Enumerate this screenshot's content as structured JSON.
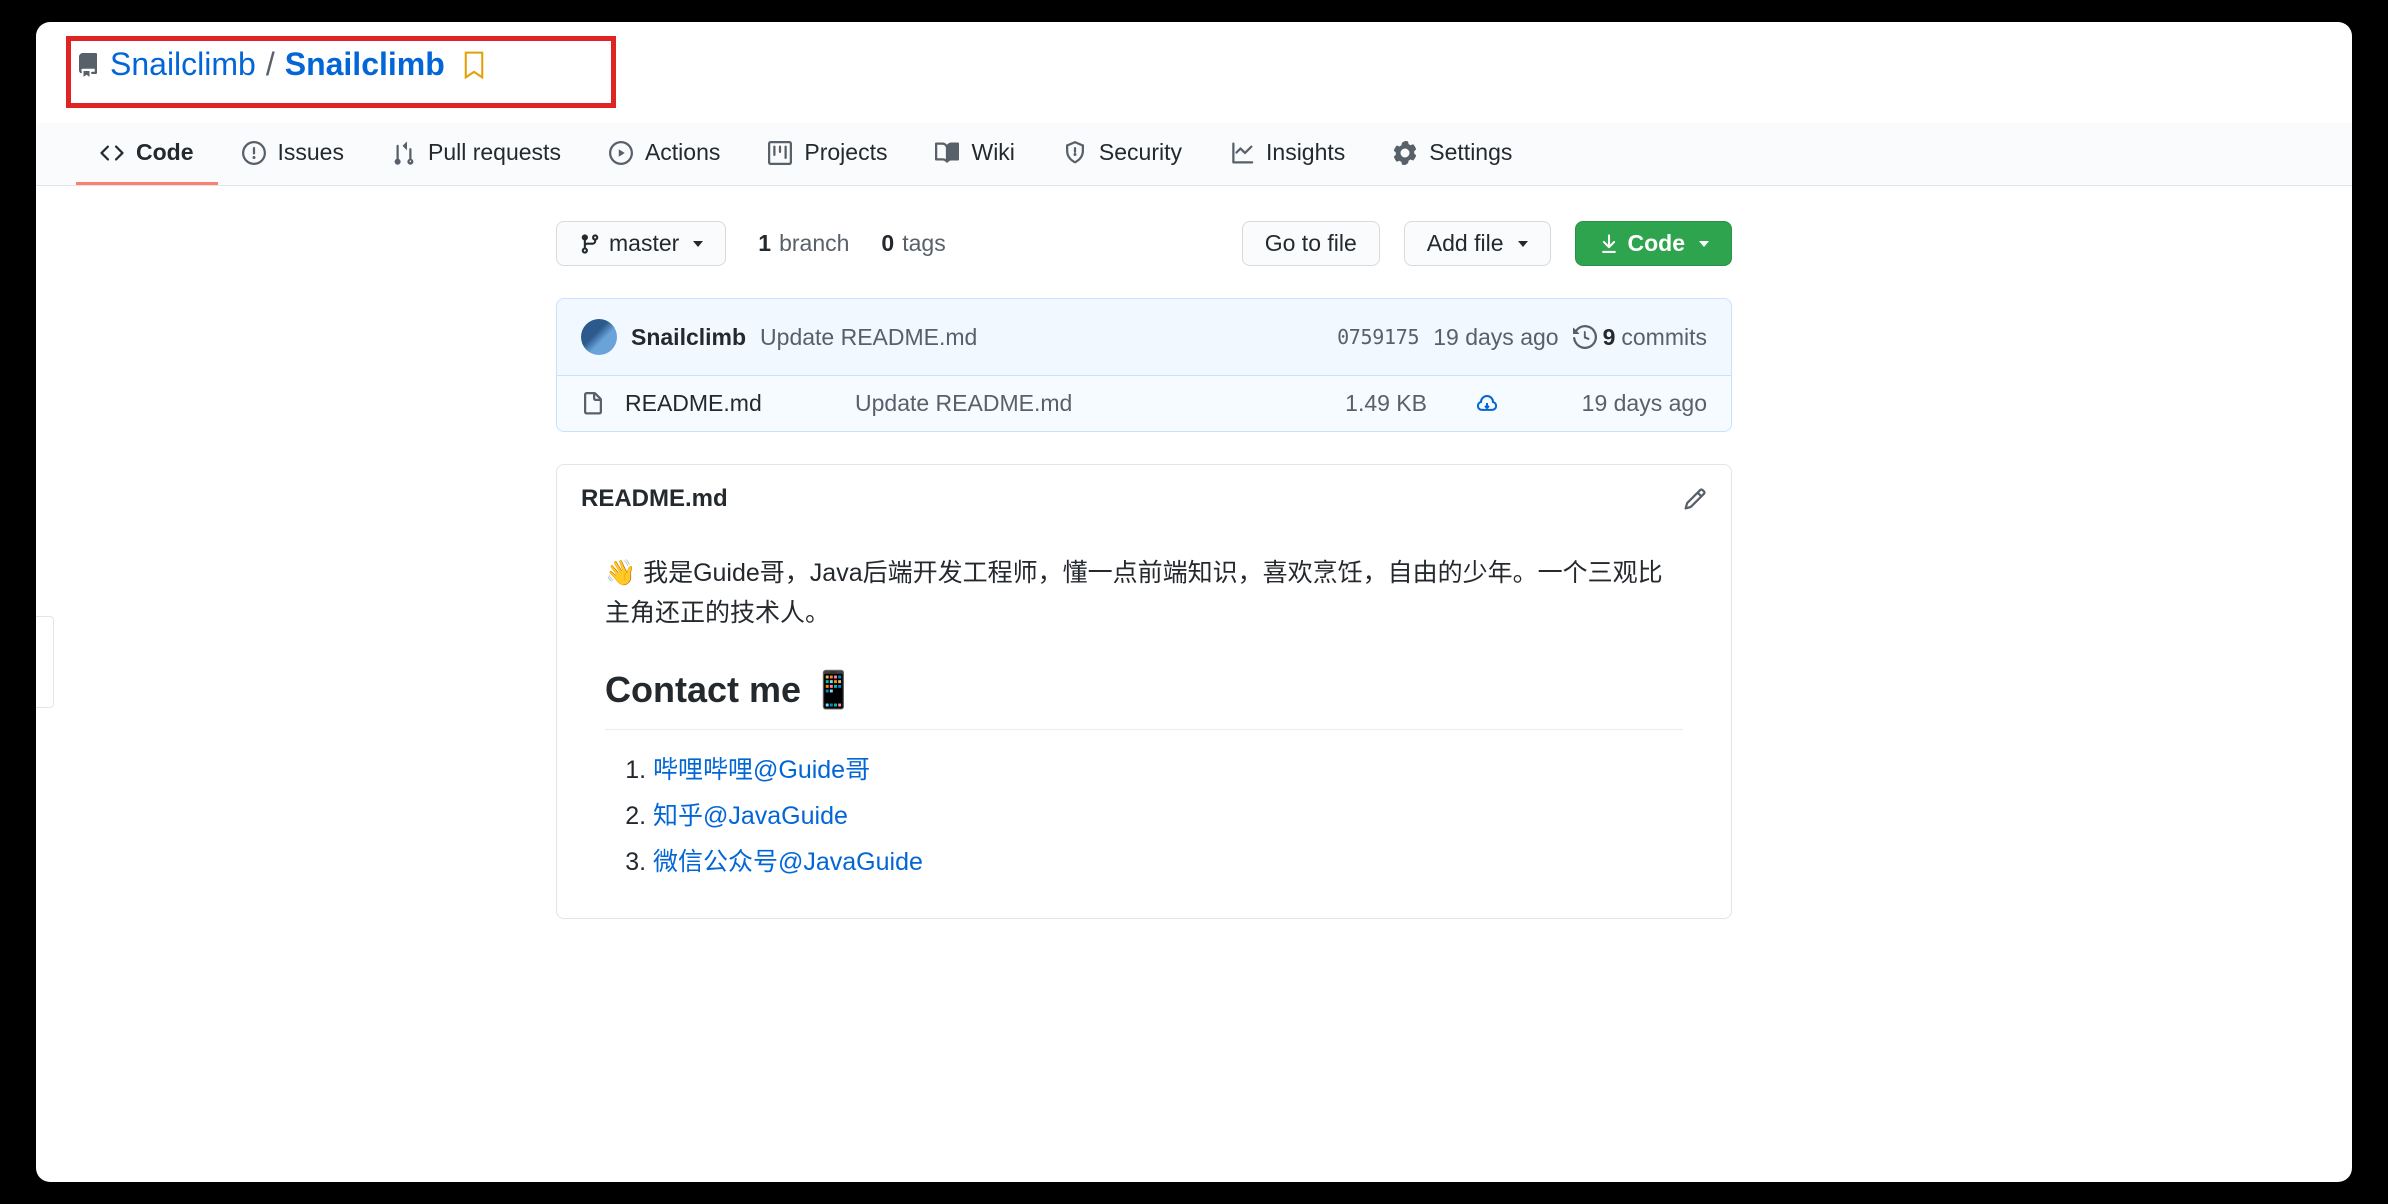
{
  "repo": {
    "owner": "Snailclimb",
    "separator": "/",
    "name": "Snailclimb"
  },
  "tabs": [
    {
      "label": "Code"
    },
    {
      "label": "Issues"
    },
    {
      "label": "Pull requests"
    },
    {
      "label": "Actions"
    },
    {
      "label": "Projects"
    },
    {
      "label": "Wiki"
    },
    {
      "label": "Security"
    },
    {
      "label": "Insights"
    },
    {
      "label": "Settings"
    }
  ],
  "toolbar": {
    "branch_label": "master",
    "branch_count": "1",
    "branch_word": "branch",
    "tag_count": "0",
    "tag_word": "tags",
    "go_to_file": "Go to file",
    "add_file": "Add file",
    "code": "Code"
  },
  "commit": {
    "author": "Snailclimb",
    "message": "Update README.md",
    "sha": "0759175",
    "time": "19 days ago",
    "count": "9",
    "count_word": "commits"
  },
  "files": [
    {
      "name": "README.md",
      "message": "Update README.md",
      "size": "1.49 KB",
      "time": "19 days ago"
    }
  ],
  "readme": {
    "filename": "README.md",
    "intro": "👋 我是Guide哥，Java后端开发工程师，懂一点前端知识，喜欢烹饪，自由的少年。一个三观比主角还正的技术人。",
    "contact_heading": "Contact me 📱",
    "links": [
      "哔哩哔哩@Guide哥",
      "知乎@JavaGuide",
      "微信公众号@JavaGuide"
    ]
  }
}
